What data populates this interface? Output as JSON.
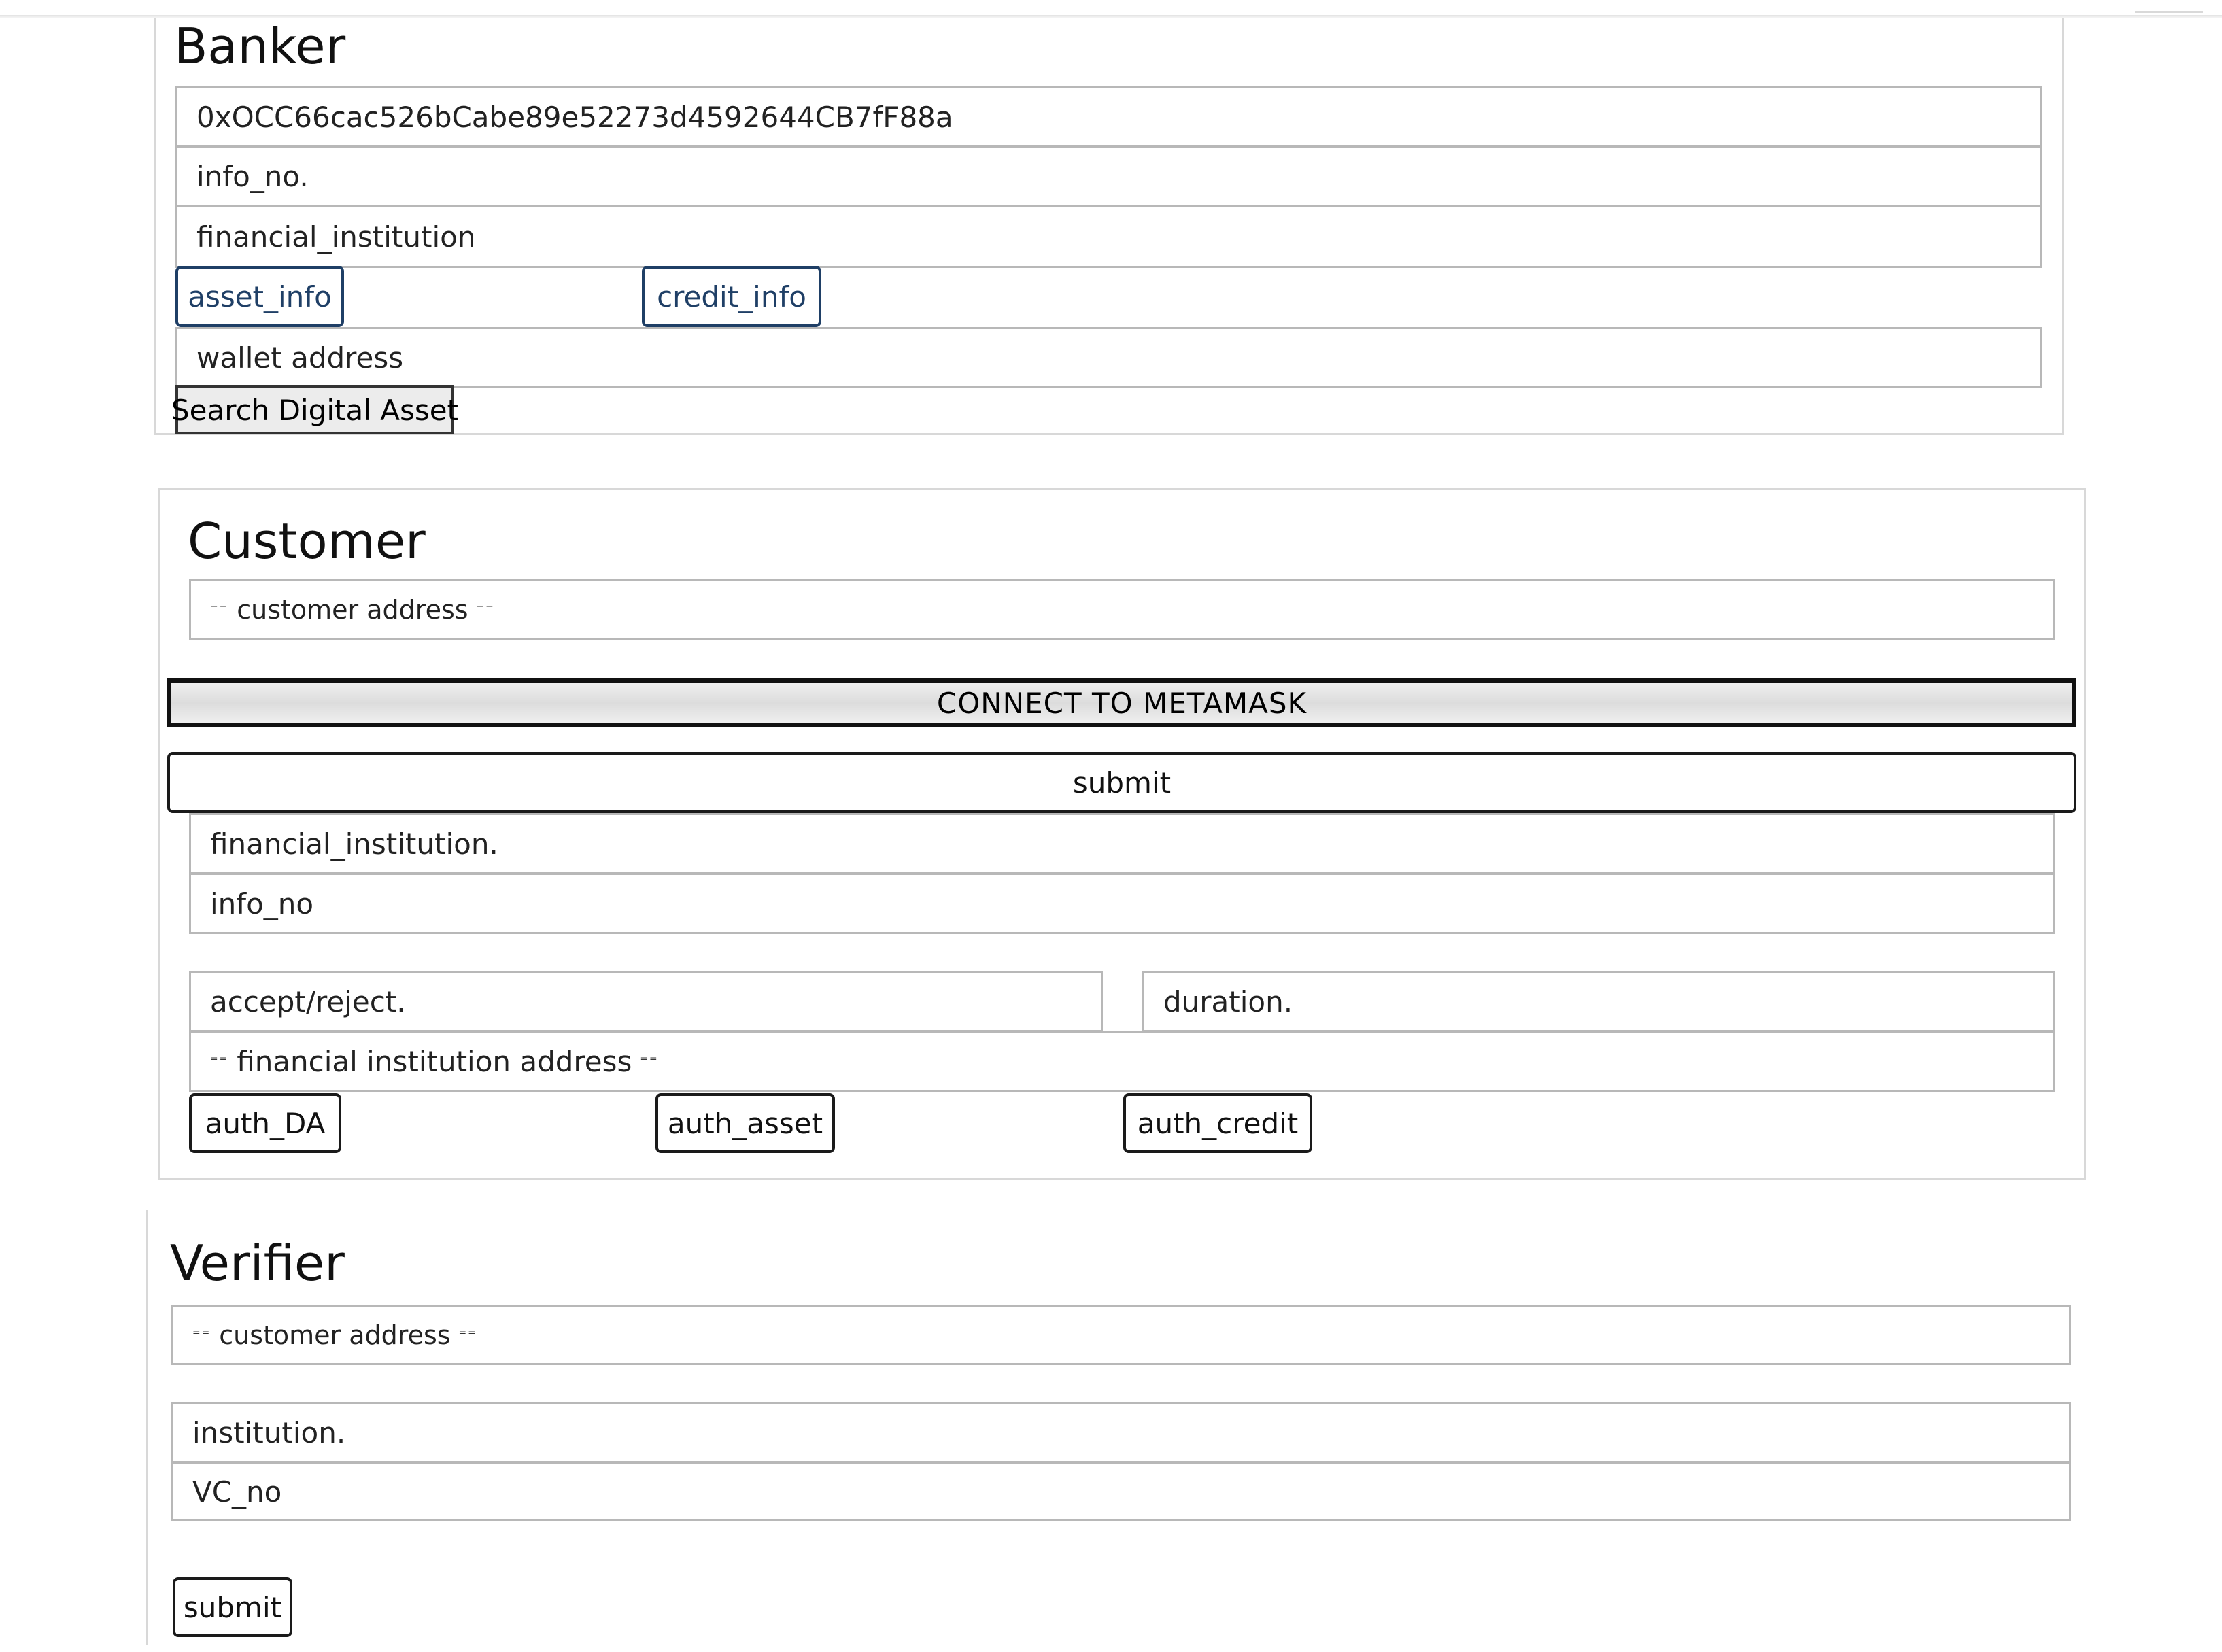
{
  "banker": {
    "title": "Banker",
    "address_value": "0xOCC66cac526bCabe89e52273d4592644CB7fF88a",
    "info_no_placeholder": "info_no.",
    "financial_institution_placeholder": "financial_institution",
    "asset_info_label": "asset_info",
    "credit_info_label": "credit_info",
    "wallet_address_placeholder": "wallet address",
    "search_button_label": "Search Digital Asset"
  },
  "customer": {
    "title": "Customer",
    "customer_address_placeholder": "customer address",
    "connect_button_label": "CONNECT TO METAMASK",
    "submit_label": "submit",
    "financial_institution_placeholder": "financial_institution.",
    "info_no_placeholder": "info_no",
    "accept_reject_placeholder": "accept/reject.",
    "duration_placeholder": "duration.",
    "fi_address_placeholder": "financial institution address",
    "auth_da_label": "auth_DA",
    "auth_asset_label": "auth_asset",
    "auth_credit_label": "auth_credit"
  },
  "verifier": {
    "title": "Verifier",
    "customer_address_placeholder": "customer address",
    "institution_placeholder": "institution.",
    "vc_no_placeholder": "VC_no",
    "submit_label": "submit"
  },
  "colors": {
    "field_border": "#b8b8b8",
    "panel_border": "#d8d8d8",
    "blue_button": "#1f3f66",
    "black_button": "#1a1a1a"
  }
}
